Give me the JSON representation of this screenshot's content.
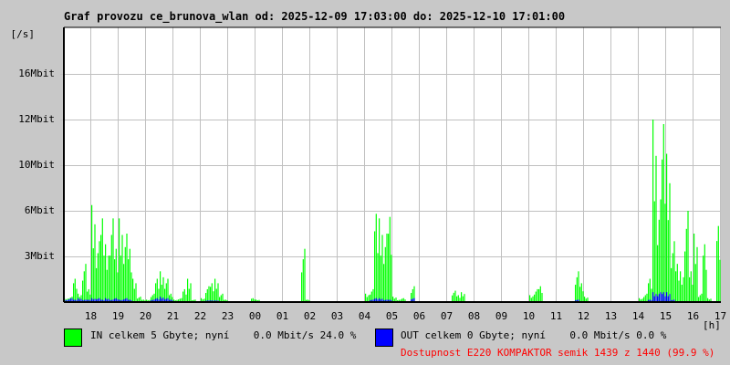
{
  "chart_data": {
    "type": "area",
    "title": "Graf provozu ce_brunova_wlan od: 2025-12-09 17:03:00 do: 2025-12-10 17:01:00",
    "ylabel": "[/s]",
    "xlabel": "[h]",
    "y_ticks": [
      {
        "label": "3Mbit",
        "value": 3
      },
      {
        "label": "6Mbit",
        "value": 6
      },
      {
        "label": "10Mbit",
        "value": 10
      },
      {
        "label": "12Mbit",
        "value": 12
      },
      {
        "label": "16Mbit",
        "value": 16
      }
    ],
    "x_ticks": [
      "18",
      "19",
      "20",
      "21",
      "22",
      "23",
      "00",
      "01",
      "02",
      "03",
      "04",
      "05",
      "06",
      "07",
      "08",
      "09",
      "10",
      "11",
      "12",
      "13",
      "14",
      "15",
      "16",
      "17"
    ],
    "start_time": "17:03",
    "bin_minutes": 10,
    "grid": true,
    "series": [
      {
        "name": "IN",
        "color": "#00ff00",
        "unit": "Mbit/s",
        "values": [
          0.2,
          0.3,
          1.5,
          0.5,
          2.5,
          0.8,
          6.5,
          4,
          5.5,
          3.8,
          5.5,
          3.5,
          5.5,
          4.5,
          3.5,
          1.5,
          0.3,
          0.1,
          0.1,
          0.5,
          1.5,
          2,
          1.5,
          0.5,
          0.1,
          0.2,
          0.8,
          1.5,
          0.1,
          0,
          0.2,
          1.0,
          1.2,
          1.5,
          0.5,
          0.1,
          0,
          0,
          0,
          0,
          0,
          0.2,
          0.1,
          0,
          0,
          0,
          0,
          0,
          0,
          0,
          0,
          0,
          3.5,
          0.1,
          0,
          0,
          0,
          0,
          0,
          0,
          0,
          0,
          0,
          0,
          0,
          0,
          0.5,
          0.8,
          5.8,
          5.5,
          4.5,
          5.6,
          0.3,
          0.1,
          0.2,
          0,
          1.0,
          0,
          0,
          0,
          0,
          0,
          0,
          0,
          0,
          0.7,
          0.4,
          0.6,
          0,
          0,
          0,
          0,
          0,
          0,
          0,
          0,
          0,
          0,
          0,
          0,
          0,
          0,
          0.4,
          0.8,
          1.0,
          0,
          0,
          0,
          0,
          0,
          0,
          0,
          2.0,
          1.2,
          0.3,
          0,
          0,
          0,
          0,
          0,
          0,
          0,
          0,
          0,
          0,
          0,
          0.2,
          0.5,
          1.5,
          12,
          7,
          11.8,
          10.5,
          4,
          2.5,
          2.0,
          6.0,
          2.0,
          4.5,
          0.5,
          3.8,
          0.2,
          0,
          5.0
        ]
      },
      {
        "name": "OUT",
        "color": "#0000ff",
        "unit": "Mbit/s",
        "values": [
          0.1,
          0.2,
          0.1,
          0.2,
          0.1,
          0.1,
          0.2,
          0.2,
          0.1,
          0.2,
          0.1,
          0.2,
          0.1,
          0.2,
          0.1,
          0,
          0,
          0,
          0,
          0.1,
          0.2,
          0.3,
          0.2,
          0.1,
          0,
          0,
          0,
          0,
          0,
          0,
          0,
          0.05,
          0.05,
          0.05,
          0,
          0,
          0,
          0,
          0,
          0,
          0,
          0,
          0,
          0,
          0,
          0,
          0,
          0,
          0,
          0,
          0,
          0,
          0,
          0,
          0,
          0,
          0,
          0,
          0,
          0,
          0,
          0,
          0,
          0,
          0,
          0,
          0,
          0.1,
          0.2,
          0.2,
          0.1,
          0.1,
          0,
          0,
          0,
          0,
          0.2,
          0,
          0,
          0,
          0,
          0,
          0,
          0,
          0,
          0,
          0,
          0,
          0,
          0,
          0,
          0,
          0,
          0,
          0,
          0,
          0,
          0,
          0,
          0,
          0,
          0,
          0,
          0,
          0,
          0,
          0,
          0,
          0,
          0,
          0,
          0,
          0.1,
          0,
          0,
          0,
          0,
          0,
          0,
          0,
          0,
          0,
          0,
          0,
          0,
          0,
          0,
          0,
          0.1,
          0.6,
          0.6,
          0.6,
          0.6,
          0.1,
          0,
          0,
          0,
          0,
          0,
          0,
          0,
          0,
          0,
          0
        ]
      }
    ]
  },
  "legend": {
    "in_text": "IN celkem 5 Gbyte; nyní    0.0 Mbit/s 24.0 %",
    "out_text": "OUT celkem 0 Gbyte; nyní    0.0 Mbit/s 0.0 %",
    "availability": "Dostupnost E220 KOMPAKTOR semik 1439 z 1440 (99.9 %)"
  }
}
